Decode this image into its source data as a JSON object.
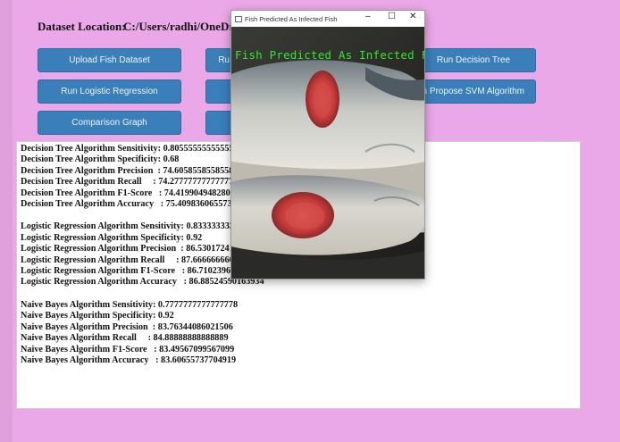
{
  "dataset": {
    "label": "Dataset Location:",
    "path": "C:/Users/radhi/OneDrive/Desk"
  },
  "buttons": {
    "upload": "Upload Fish Dataset",
    "run_svm_partial": "Ru",
    "run_decision_tree": "Run Decision Tree",
    "run_logistic": "Run Logistic Regression",
    "propose_svm_partial": "n Propose SVM Algorithm",
    "comparison": "Comparison Graph"
  },
  "results": {
    "dt": [
      "Decision Tree Algorithm Sensitivity: 0.8055555555555556",
      "Decision Tree Algorithm Specificity: 0.68",
      "Decision Tree Algorithm Precision  : 74.60585585585586",
      "Decision Tree Algorithm Recall     : 74.27777777777777",
      "Decision Tree Algorithm F1-Score   : 74.41990494828069",
      "Decision Tree Algorithm Accuracy   : 75.40983606557377"
    ],
    "lr": [
      "Logistic Regression Algorithm Sensitivity: 0.8333333333333",
      "Logistic Regression Algorithm Specificity: 0.92",
      "Logistic Regression Algorithm Precision  : 86.53017241379",
      "Logistic Regression Algorithm Recall     : 87.666666666666",
      "Logistic Regression Algorithm F1-Score   : 86.710239651416",
      "Logistic Regression Algorithm Accuracy   : 86.88524590163934"
    ],
    "nb": [
      "Naive Bayes Algorithm Sensitivity: 0.7777777777777778",
      "Naive Bayes Algorithm Specificity: 0.92",
      "Naive Bayes Algorithm Precision  : 83.76344086021506",
      "Naive Bayes Algorithm Recall     : 84.88888888888889",
      "Naive Bayes Algorithm F1-Score   : 83.49567099567099",
      "Naive Bayes Algorithm Accuracy   : 83.60655737704919"
    ]
  },
  "popup": {
    "title": "Fish Predicted As Infected Fish",
    "caption": "Fish Predicted As Infected Fish",
    "minimize": "–",
    "maximize": "☐",
    "close": "✕",
    "caption_color": "#31e82c"
  }
}
